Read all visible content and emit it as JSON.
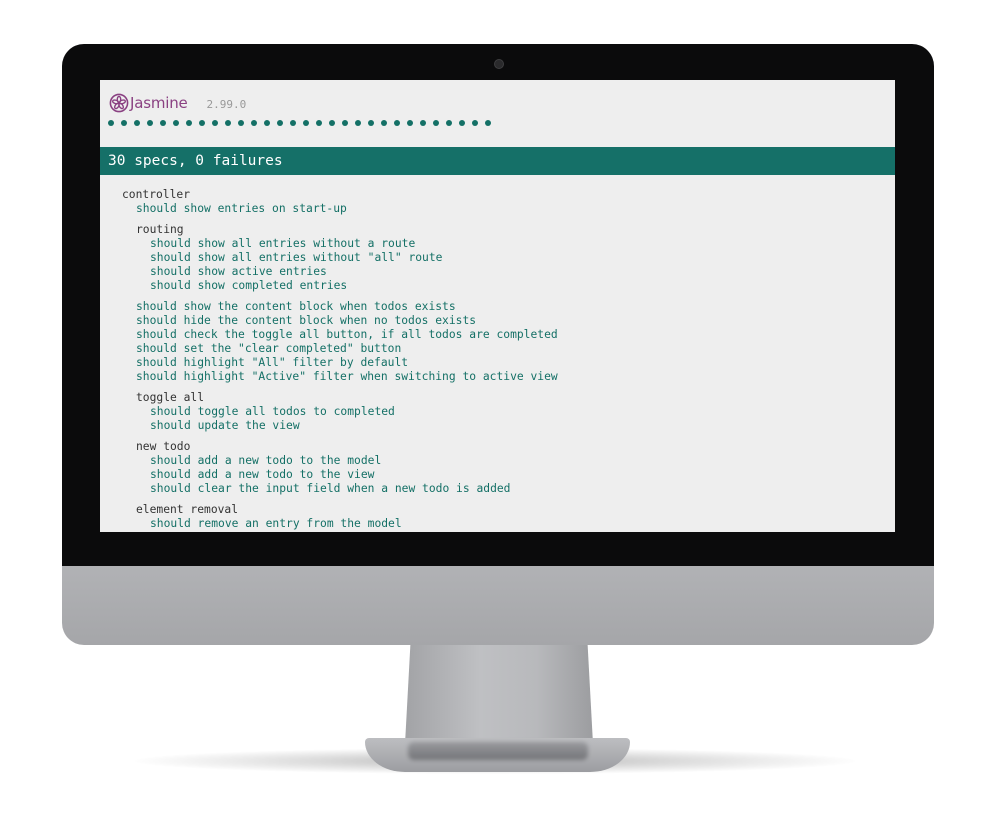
{
  "header": {
    "brand": "Jasmine",
    "version": "2.99.0",
    "passed_dot_count": 30
  },
  "summary": {
    "text": "30 specs, 0 failures",
    "status": "passed",
    "color": "#157068"
  },
  "colors": {
    "pass": "#147066",
    "brand": "#8a4182",
    "suite_text": "#333333"
  },
  "results": {
    "controller": {
      "title": "controller",
      "spec_startup": "should show entries on start-up",
      "routing": {
        "title": "routing",
        "specs": [
          "should show all entries without a route",
          "should show all entries without \"all\" route",
          "should show active entries",
          "should show completed entries"
        ]
      },
      "specs": [
        "should show the content block when todos exists",
        "should hide the content block when no todos exists",
        "should check the toggle all button, if all todos are completed",
        "should set the \"clear completed\" button",
        "should highlight \"All\" filter by default",
        "should highlight \"Active\" filter when switching to active view"
      ],
      "toggle_all": {
        "title": "toggle all",
        "specs": [
          "should toggle all todos to completed",
          "should update the view"
        ]
      },
      "new_todo": {
        "title": "new todo",
        "specs": [
          "should add a new todo to the model",
          "should add a new todo to the view",
          "should clear the input field when a new todo is added"
        ]
      },
      "element_removal": {
        "title": "element removal",
        "specs": [
          "should remove an entry from the model"
        ]
      }
    }
  }
}
